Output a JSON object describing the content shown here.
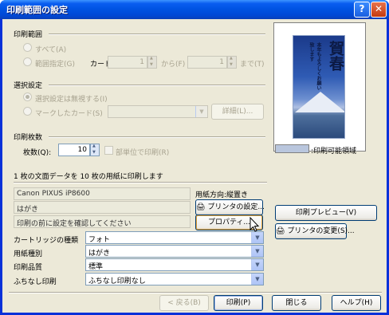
{
  "window": {
    "title": "印刷範囲の設定",
    "help_glyph": "?",
    "close_glyph": "✕"
  },
  "print_range": {
    "heading": "印刷範囲",
    "all_label": "すべて(A)",
    "range_label": "範囲指定(G)",
    "card_label": "カード",
    "from_value": "1",
    "from_label": "から(F)",
    "to_value": "1",
    "to_label": "まで(T)"
  },
  "selection": {
    "heading": "選択設定",
    "ignore_label": "選択設定は無視する(I)",
    "marked_label": "マークしたカード(S)",
    "marked_value": "",
    "detail_button": "詳細(L)..."
  },
  "copies": {
    "heading": "印刷枚数",
    "count_label": "枚数(Q):",
    "count_value": "10",
    "collate_label": "部単位で印刷(R)"
  },
  "summary_text": "1 枚の文面データを 10 枚の用紙に印刷します",
  "printer": {
    "name": "Canon PIXUS iP8600",
    "paper": "はがき",
    "orientation_label": "用紙方向:",
    "orientation_value": "縦置き",
    "printer_settings_button": "プリンタの設定...",
    "confirm_text": "印刷の前に設定を確認してください",
    "properties_button": "プロパティ..."
  },
  "options": [
    {
      "label": "カートリッジの種類",
      "value": "フォト"
    },
    {
      "label": "用紙種別",
      "value": "はがき"
    },
    {
      "label": "印刷品質",
      "value": "標準"
    },
    {
      "label": "ふちなし印刷",
      "value": "ふちなし印刷なし"
    }
  ],
  "preview": {
    "legend_label": ":印刷可能領域",
    "print_preview_button": "印刷プレビュー(V)",
    "change_printer_button": "プリンタの変更(S)...",
    "card_text_main": "賀春",
    "card_text_sub": "本年もよろしくお願い致します"
  },
  "footer": {
    "back_button": "< 戻る(B)",
    "print_button": "印刷(P)",
    "close_button": "閉じる",
    "help_button": "ヘルプ(H)"
  }
}
